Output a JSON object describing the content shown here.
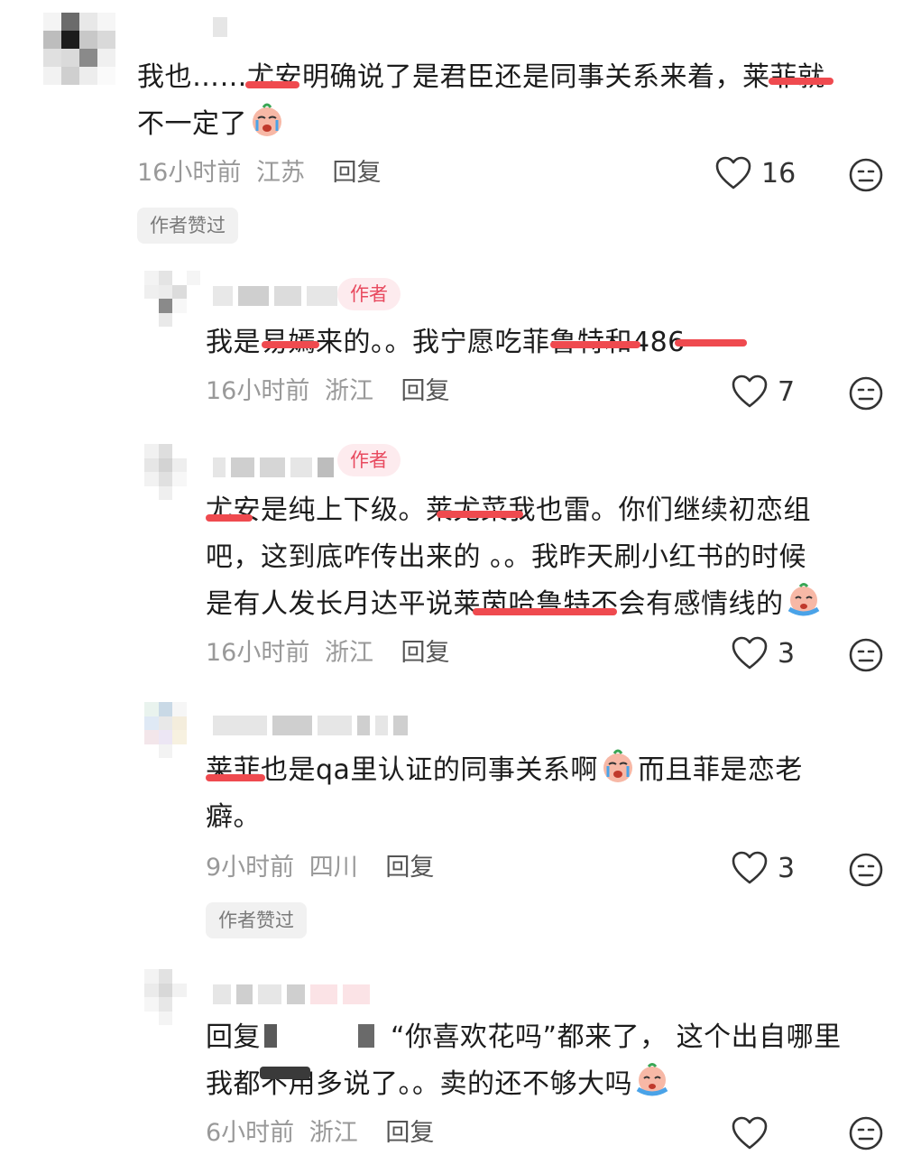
{
  "comments": [
    {
      "lines": [
        "我也……尤安明确说了是君臣还是同事关系来着，莱菲就",
        "不一定了"
      ],
      "time": "16小时前",
      "location": "江苏",
      "reply_label": "回复",
      "likes": "16",
      "liked_by_author": "作者赞过"
    },
    {
      "author_tag": "作者",
      "lines": [
        "我是易嫣来的。。我宁愿吃菲鲁特和486"
      ],
      "time": "16小时前",
      "location": "浙江",
      "reply_label": "回复",
      "likes": "7"
    },
    {
      "author_tag": "作者",
      "lines": [
        "尤安是纯上下级。莱尤菜我也雷。你们继续初恋组",
        "吧，这到底咋传出来的 。。我昨天刷小红书的时候",
        "是有人发长月达平说莱茵哈鲁特不会有感情线的"
      ],
      "time": "16小时前",
      "location": "浙江",
      "reply_label": "回复",
      "likes": "3"
    },
    {
      "lines": [
        "莱菲也是qa里认证的同事关系啊",
        "而且菲是恋老",
        "癖。"
      ],
      "time": "9小时前",
      "location": "四川",
      "reply_label": "回复",
      "likes": "3",
      "liked_by_author": "作者赞过"
    },
    {
      "lines": [
        "回复",
        "“你喜欢花吗”都来了， 这个出自哪里",
        "我都不用多说了。。卖的还不够大吗"
      ],
      "time": "6小时前",
      "location": "浙江",
      "reply_label": "回复",
      "likes": ""
    }
  ],
  "icons": {
    "like": "heart-outline-icon",
    "dislike": "meh-face-icon",
    "emoji_cry": "crying-face-emoji",
    "emoji_sob": "sobbing-face-emoji"
  },
  "colors": {
    "strike": "#ef4a4f",
    "author_tag_bg": "#fdebee",
    "author_tag_text": "#e84a5f",
    "meta": "#999999"
  }
}
